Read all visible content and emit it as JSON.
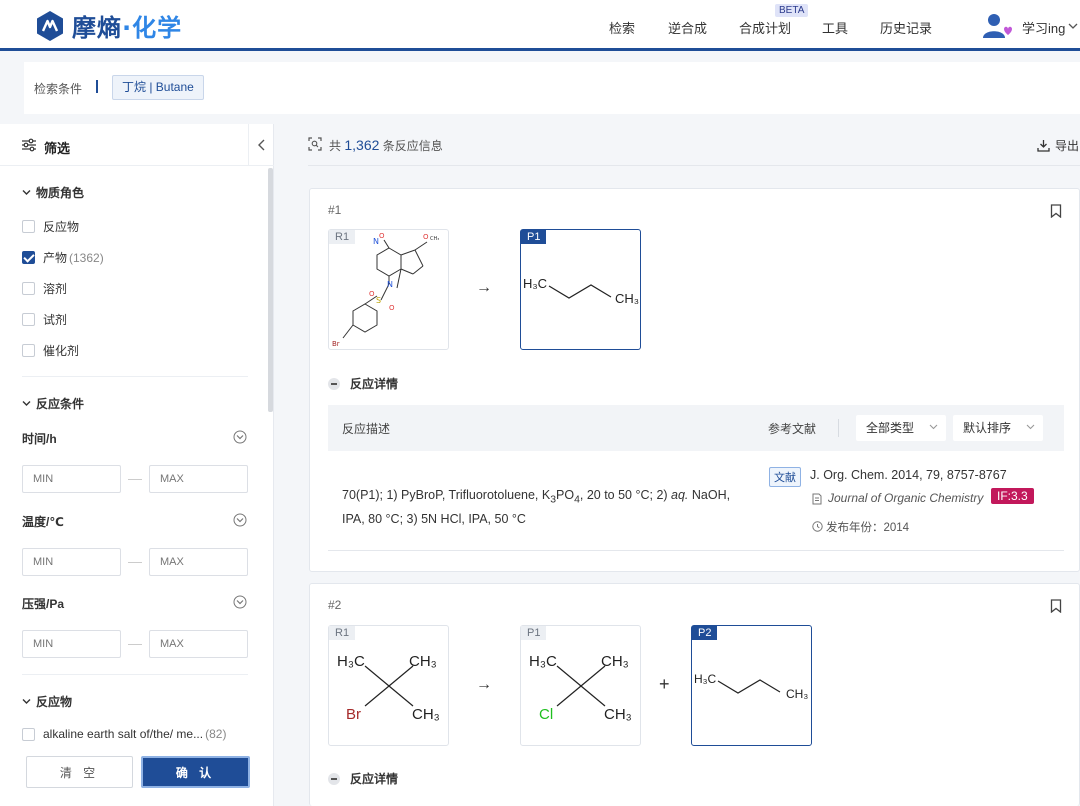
{
  "header": {
    "logo_main": "摩熵",
    "logo_accent": "·化学",
    "nav": [
      "检索",
      "逆合成",
      "合成计划",
      "工具",
      "历史记录"
    ],
    "beta_label": "BETA",
    "username": "学习ing"
  },
  "search": {
    "label": "检索条件",
    "chip": "丁烷 | Butane"
  },
  "sidebar": {
    "title": "筛选",
    "role_section": "物质角色",
    "roles": [
      {
        "label": "反应物",
        "count": "",
        "checked": false
      },
      {
        "label": "产物",
        "count": "(1362)",
        "checked": true
      },
      {
        "label": "溶剂",
        "count": "",
        "checked": false
      },
      {
        "label": "试剂",
        "count": "",
        "checked": false
      },
      {
        "label": "催化剂",
        "count": "",
        "checked": false
      }
    ],
    "conditions_section": "反应条件",
    "ranges": [
      {
        "label": "时间/h",
        "min_placeholder": "MIN",
        "max_placeholder": "MAX"
      },
      {
        "label": "温度/℃",
        "min_placeholder": "MIN",
        "max_placeholder": "MAX"
      },
      {
        "label": "压强/Pa",
        "min_placeholder": "MIN",
        "max_placeholder": "MAX"
      }
    ],
    "reactant_section": "反应物",
    "reactant_item": {
      "label": "alkaline earth salt of/the/ me...",
      "count": "(82)"
    },
    "clear_label": "清 空",
    "confirm_label": "确 认"
  },
  "results": {
    "prefix": "共",
    "count": "1,362",
    "suffix": "条反应信息",
    "export_label": "导出"
  },
  "reactions": [
    {
      "number": "#1",
      "reactant_tag": "R1",
      "product_tag": "P1",
      "product_labels": {
        "left": "H₃C",
        "right": "CH₃"
      },
      "details_toggle": "反应详情",
      "table": {
        "col_desc": "反应描述",
        "col_ref": "参考文献",
        "type_select": "全部类型",
        "sort_select": "默认排序"
      },
      "description": {
        "part1": "70(P1); 1) PyBroP, Trifluorotoluene, K",
        "sub3": "3",
        "part2": "PO",
        "sub4": "4",
        "part3": ", 20 to 50 °C; 2) ",
        "aq": "aq.",
        "part4": " NaOH, IPA, 80 °C; 3) 5N HCl, IPA, 50 °C"
      },
      "ref_tag": "文献",
      "ref_title": "J. Org. Chem. 2014, 79, 8757-8767",
      "journal": "Journal of Organic Chemistry",
      "impact_factor": "IF:3.3",
      "year_label": "发布年份：2014",
      "reactant_atoms": {
        "n": "N",
        "o": "O",
        "ch3": "CH₃",
        "s": "S",
        "br": "Br"
      }
    },
    {
      "number": "#2",
      "reactant_tag": "R1",
      "product1_tag": "P1",
      "product2_tag": "P2",
      "reactant_labels": {
        "tl": "H₃C",
        "tr": "CH₃",
        "bl": "Br",
        "br": "CH₃"
      },
      "product1_labels": {
        "tl": "H₃C",
        "tr": "CH₃",
        "bl": "Cl",
        "br": "CH₃"
      },
      "product2_labels": {
        "left": "H₃C",
        "right": "CH₃"
      },
      "details_toggle": "反应详情"
    }
  ],
  "colors": {
    "brand": "#1f4d97",
    "accent": "#2f86e6",
    "if_badge": "#c2185b",
    "bromine": "#a52a2a",
    "chlorine": "#1fbf1f"
  }
}
